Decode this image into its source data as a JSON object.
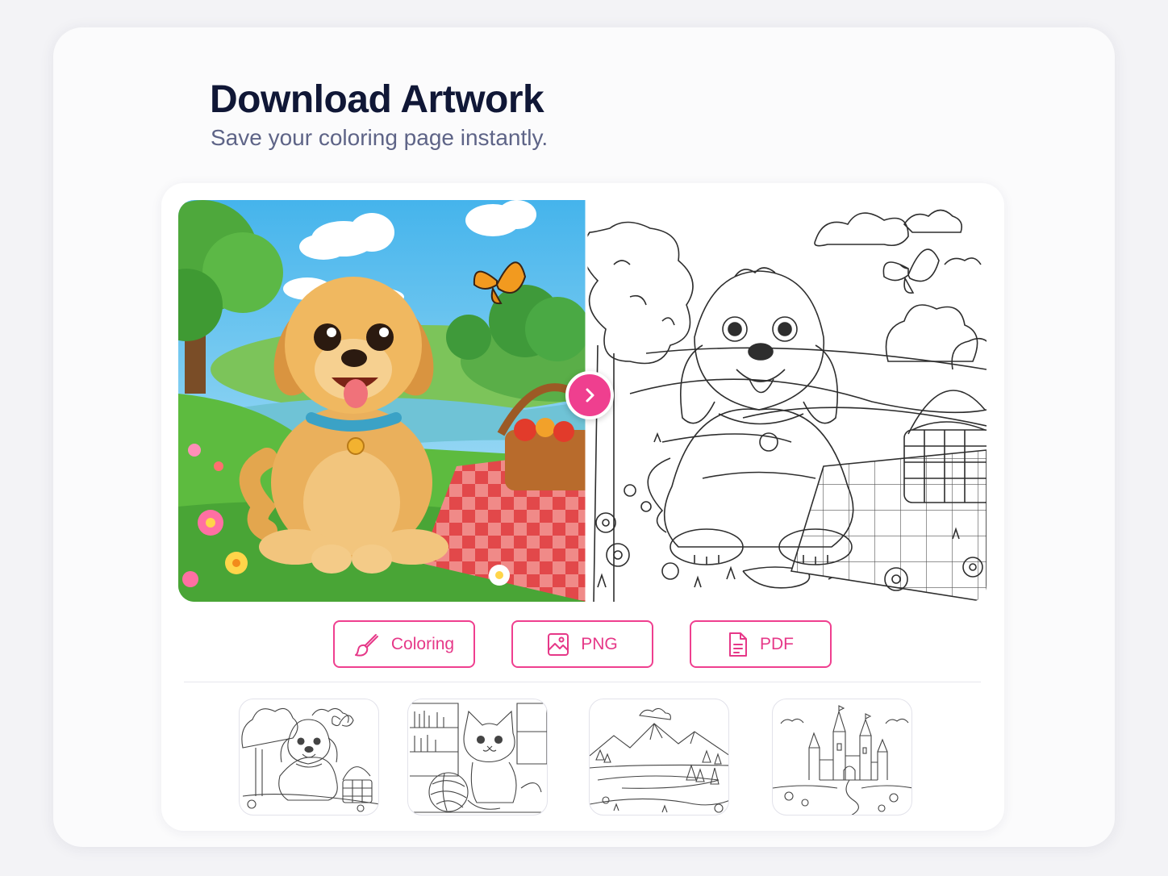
{
  "header": {
    "title": "Download Artwork",
    "subtitle": "Save your coloring page instantly."
  },
  "preview": {
    "left_image": "colored-puppy-picnic",
    "right_image": "puppy-picnic-line-art",
    "toggle_icon": "chevron-right-icon"
  },
  "actions": [
    {
      "label": "Coloring",
      "icon": "brush-icon"
    },
    {
      "label": "PNG",
      "icon": "image-icon"
    },
    {
      "label": "PDF",
      "icon": "document-icon"
    }
  ],
  "gallery": [
    {
      "subject": "puppy-picnic"
    },
    {
      "subject": "kitten-yarn"
    },
    {
      "subject": "mountain-lake"
    },
    {
      "subject": "castle"
    }
  ],
  "colors": {
    "accent": "#ef3f8f",
    "title": "#101736",
    "subtitle": "#5e6487"
  }
}
